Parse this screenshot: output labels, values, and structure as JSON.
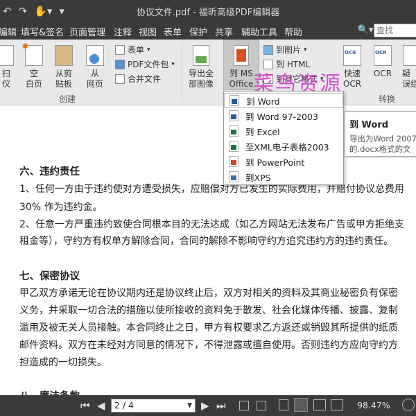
{
  "window": {
    "title": "协议文件.pdf - 福昕高级PDF编辑器",
    "quick_access": [
      "↶",
      "↷",
      "✋▾",
      "▾"
    ]
  },
  "menu": {
    "items": [
      "编辑",
      "填写&签名",
      "页面管理",
      "注释",
      "视图",
      "表单",
      "保护",
      "共享",
      "辅助工具",
      "帮助"
    ],
    "search_placeholder": "查找"
  },
  "ribbon": {
    "scan_label": "扫\n仪",
    "blank_label": "空\n白页",
    "clipboard_label": "从剪\n贴板",
    "web_label": "从\n网页",
    "form_label": "表单",
    "pdf_package_label": "PDF文件包",
    "merge_label": "合并文件",
    "create_group": "创建",
    "export_images_label": "导出全\n部图像",
    "ms_office_label": "到 MS\nOffice",
    "to_image_label": "到图片",
    "to_html_label": "到 HTML",
    "to_other_label": "到其它格式",
    "quick_ocr_label": "快速\nOCR",
    "ocr_label": "OCR",
    "suspect_label": "疑\n误结",
    "convert_group": "转换"
  },
  "watermark": "菜鸟资源",
  "dropdown": {
    "items": [
      {
        "label": "到 Word",
        "icon_color": "#2b5797"
      },
      {
        "label": "到 Word 97-2003",
        "icon_color": "#2b5797"
      },
      {
        "label": "到 Excel",
        "icon_color": "#1e7145"
      },
      {
        "label": "至XML电子表格2003",
        "icon_color": "#1e7145"
      },
      {
        "label": "到 PowerPoint",
        "icon_color": "#d24726"
      },
      {
        "label": "到XPS",
        "icon_color": "#3a6ea5"
      }
    ]
  },
  "tooltip": {
    "title": "到 Word",
    "desc_1": "导出为Word 2007",
    "desc_2": "的.docx格式的文"
  },
  "document": {
    "lines": [
      {
        "text": "六、违约责任",
        "heading": true
      },
      {
        "text": "1、任何一方由于违约使对方遭受损失，应赔偿对方已发生的实际费用，并赔付协议总费用"
      },
      {
        "text": "30%  作为违约金。"
      },
      {
        "text": "2、任意一方严重违约致使合同根本目的无法达成（如乙方网站无法发布广告或甲方拒绝支"
      },
      {
        "text": "租金等），守约方有权单方解除合同，合同的解除不影响守约方追究违约方的违约责任。"
      },
      {
        "text": "七、保密协议",
        "heading": true
      },
      {
        "text": "甲乙双方承诺无论在协议期内还是协议终止后，双方对相关的资料及其商业秘密负有保密"
      },
      {
        "text": "义务，并采取一切合法的措施以使所接收的资料免于散发、社会化媒体传播、披露、复制"
      },
      {
        "text": "滥用及被无关人员接触。本合同终止之日，甲方有权要求乙方返还或销毁其所提供的纸质"
      },
      {
        "text": "邮件资料。双方在未经对方同意的情况下，不得泄露或擅自使用。否则违约方应向守约方"
      },
      {
        "text": "担造成的一切损失。"
      },
      {
        "text": "八、廉洁条款",
        "heading": true
      }
    ]
  },
  "status": {
    "first_page": "⏮",
    "prev_page": "◀",
    "page_value": "2 / 4",
    "next_page": "▶",
    "last_page": "⏭",
    "zoom": "98.47%"
  }
}
